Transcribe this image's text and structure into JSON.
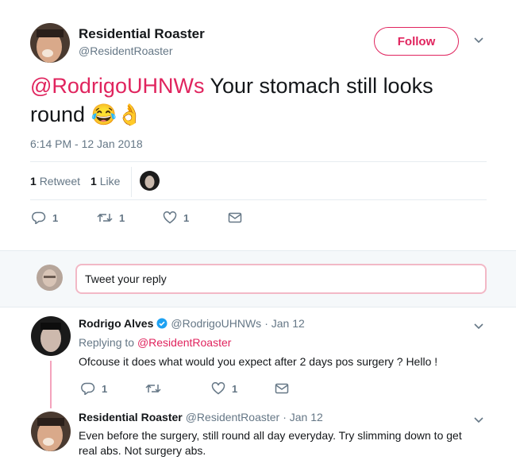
{
  "main_tweet": {
    "author_name": "Residential Roaster",
    "author_handle": "@ResidentRoaster",
    "follow_label": "Follow",
    "mention": "@RodrigoUHNWs",
    "text_line1": " Your stomach still looks",
    "text_line2": "round",
    "emoji": "😂👌",
    "timestamp": "6:14 PM - 12 Jan 2018",
    "retweets_count": "1",
    "retweets_label": "Retweet",
    "likes_count": "1",
    "likes_label": "Like",
    "actions": {
      "reply_count": "1",
      "retweet_count": "1",
      "like_count": "1"
    }
  },
  "reply_box": {
    "placeholder": "Tweet your reply"
  },
  "replies": [
    {
      "author_name": "Rodrigo Alves",
      "verified": true,
      "author_handle": "@RodrigoUHNWs",
      "date": "· Jan 12",
      "replying_prefix": "Replying to ",
      "replying_to": "@ResidentRoaster",
      "text": "Ofcouse it does what would you expect after 2 days pos surgery ? Hello !",
      "actions": {
        "reply_count": "1",
        "retweet_count": "",
        "like_count": "1"
      }
    },
    {
      "author_name": "Residential Roaster",
      "author_handle": "@ResidentRoaster",
      "date": "· Jan 12",
      "text_line1": "Even before the surgery, still round all day everyday. Try slimming down to get",
      "text_line2": "real abs. Not surgery abs."
    }
  ],
  "colors": {
    "accent": "#e0245e",
    "text": "#14171a",
    "muted": "#657786",
    "verified": "#1da1f2"
  }
}
